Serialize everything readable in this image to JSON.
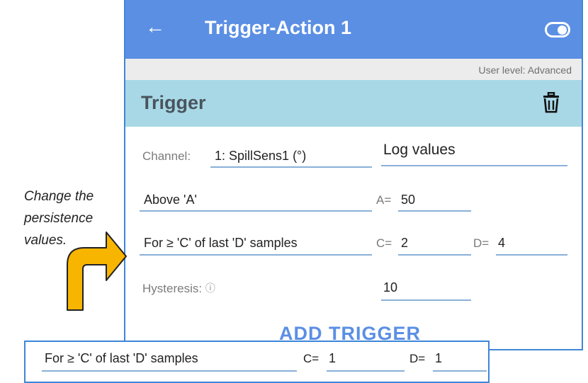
{
  "appbar": {
    "title": "Trigger-Action 1",
    "back_icon": "arrow-left-icon",
    "toggle_icon": "toggle-switch-icon"
  },
  "user_level": "User level: Advanced",
  "section": {
    "title": "Trigger",
    "delete_icon": "trash-icon"
  },
  "channel": {
    "label": "Channel:",
    "value": "1: SpillSens1 (°)",
    "log_option": "Log values"
  },
  "condition": {
    "value": "Above 'A'",
    "a_label": "A=",
    "a_value": "50"
  },
  "persistence": {
    "value": "For ≥ 'C' of last 'D' samples",
    "c_label": "C=",
    "c_value": "2",
    "d_label": "D=",
    "d_value": "4"
  },
  "hysteresis": {
    "label": "Hysteresis:",
    "info_icon": "info-icon",
    "value": "10"
  },
  "add_trigger_label": "ADD TRIGGER",
  "annotation": {
    "line1": "Change the",
    "line2": "persistence",
    "line3": "values."
  },
  "zoom": {
    "value": "For ≥ 'C' of last 'D' samples",
    "c_label": "C=",
    "c_value": "1",
    "d_label": "D=",
    "d_value": "1"
  },
  "colors": {
    "appbar": "#5b8fe4",
    "section": "#a8d8e6",
    "arrow_fill": "#f7b500",
    "border": "#3e86d8"
  }
}
